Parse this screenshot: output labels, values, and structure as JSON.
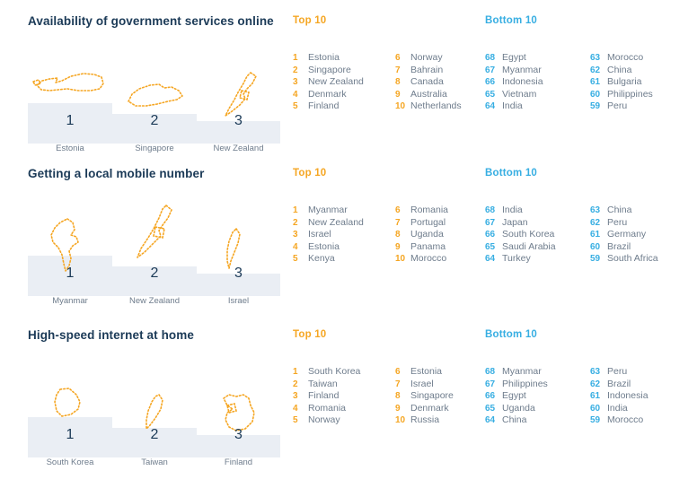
{
  "colors": {
    "title": "#1b3a57",
    "top_accent": "#f5a623",
    "bottom_accent": "#37aee2",
    "podium_fill": "#eaeef4",
    "label_text": "#6e7c8c",
    "map_outline": "#f5a623"
  },
  "labels": {
    "top_heading": "Top 10",
    "bottom_heading": "Bottom 10"
  },
  "sections": [
    {
      "title": "Availability of government services online",
      "podium": [
        {
          "rank": "1",
          "country": "Estonia",
          "map": "estonia-map-icon"
        },
        {
          "rank": "2",
          "country": "Singapore",
          "map": "singapore-map-icon"
        },
        {
          "rank": "3",
          "country": "New Zealand",
          "map": "new-zealand-map-icon"
        }
      ],
      "top": {
        "col_a": [
          {
            "rank": "1",
            "country": "Estonia"
          },
          {
            "rank": "2",
            "country": "Singapore"
          },
          {
            "rank": "3",
            "country": "New Zealand"
          },
          {
            "rank": "4",
            "country": "Denmark"
          },
          {
            "rank": "5",
            "country": "Finland"
          }
        ],
        "col_b": [
          {
            "rank": "6",
            "country": "Norway"
          },
          {
            "rank": "7",
            "country": "Bahrain"
          },
          {
            "rank": "8",
            "country": "Canada"
          },
          {
            "rank": "9",
            "country": "Australia"
          },
          {
            "rank": "10",
            "country": "Netherlands"
          }
        ]
      },
      "bottom": {
        "col_a": [
          {
            "rank": "68",
            "country": "Egypt"
          },
          {
            "rank": "67",
            "country": "Myanmar"
          },
          {
            "rank": "66",
            "country": "Indonesia"
          },
          {
            "rank": "65",
            "country": "Vietnam"
          },
          {
            "rank": "64",
            "country": "India"
          }
        ],
        "col_b": [
          {
            "rank": "63",
            "country": "Morocco"
          },
          {
            "rank": "62",
            "country": "China"
          },
          {
            "rank": "61",
            "country": "Bulgaria"
          },
          {
            "rank": "60",
            "country": "Philippines"
          },
          {
            "rank": "59",
            "country": "Peru"
          }
        ]
      }
    },
    {
      "title": "Getting a local mobile number",
      "podium": [
        {
          "rank": "1",
          "country": "Myanmar",
          "map": "myanmar-map-icon"
        },
        {
          "rank": "2",
          "country": "New Zealand",
          "map": "new-zealand-map-icon"
        },
        {
          "rank": "3",
          "country": "Israel",
          "map": "israel-map-icon"
        }
      ],
      "top": {
        "col_a": [
          {
            "rank": "1",
            "country": "Myanmar"
          },
          {
            "rank": "2",
            "country": "New Zealand"
          },
          {
            "rank": "3",
            "country": "Israel"
          },
          {
            "rank": "4",
            "country": "Estonia"
          },
          {
            "rank": "5",
            "country": "Kenya"
          }
        ],
        "col_b": [
          {
            "rank": "6",
            "country": "Romania"
          },
          {
            "rank": "7",
            "country": "Portugal"
          },
          {
            "rank": "8",
            "country": "Uganda"
          },
          {
            "rank": "9",
            "country": "Panama"
          },
          {
            "rank": "10",
            "country": "Morocco"
          }
        ]
      },
      "bottom": {
        "col_a": [
          {
            "rank": "68",
            "country": "India"
          },
          {
            "rank": "67",
            "country": "Japan"
          },
          {
            "rank": "66",
            "country": "South Korea"
          },
          {
            "rank": "65",
            "country": "Saudi Arabia"
          },
          {
            "rank": "64",
            "country": "Turkey"
          }
        ],
        "col_b": [
          {
            "rank": "63",
            "country": "China"
          },
          {
            "rank": "62",
            "country": "Peru"
          },
          {
            "rank": "61",
            "country": "Germany"
          },
          {
            "rank": "60",
            "country": "Brazil"
          },
          {
            "rank": "59",
            "country": "South Africa"
          }
        ]
      }
    },
    {
      "title": "High-speed internet at home",
      "podium": [
        {
          "rank": "1",
          "country": "South Korea",
          "map": "south-korea-map-icon"
        },
        {
          "rank": "2",
          "country": "Taiwan",
          "map": "taiwan-map-icon"
        },
        {
          "rank": "3",
          "country": "Finland",
          "map": "finland-map-icon"
        }
      ],
      "top": {
        "col_a": [
          {
            "rank": "1",
            "country": "South Korea"
          },
          {
            "rank": "2",
            "country": "Taiwan"
          },
          {
            "rank": "3",
            "country": "Finland"
          },
          {
            "rank": "4",
            "country": "Romania"
          },
          {
            "rank": "5",
            "country": "Norway"
          }
        ],
        "col_b": [
          {
            "rank": "6",
            "country": "Estonia"
          },
          {
            "rank": "7",
            "country": "Israel"
          },
          {
            "rank": "8",
            "country": "Singapore"
          },
          {
            "rank": "9",
            "country": "Denmark"
          },
          {
            "rank": "10",
            "country": "Russia"
          }
        ]
      },
      "bottom": {
        "col_a": [
          {
            "rank": "68",
            "country": "Myanmar"
          },
          {
            "rank": "67",
            "country": "Philippines"
          },
          {
            "rank": "66",
            "country": "Egypt"
          },
          {
            "rank": "65",
            "country": "Uganda"
          },
          {
            "rank": "64",
            "country": "China"
          }
        ],
        "col_b": [
          {
            "rank": "63",
            "country": "Peru"
          },
          {
            "rank": "62",
            "country": "Brazil"
          },
          {
            "rank": "61",
            "country": "Indonesia"
          },
          {
            "rank": "60",
            "country": "India"
          },
          {
            "rank": "59",
            "country": "Morocco"
          }
        ]
      }
    }
  ]
}
